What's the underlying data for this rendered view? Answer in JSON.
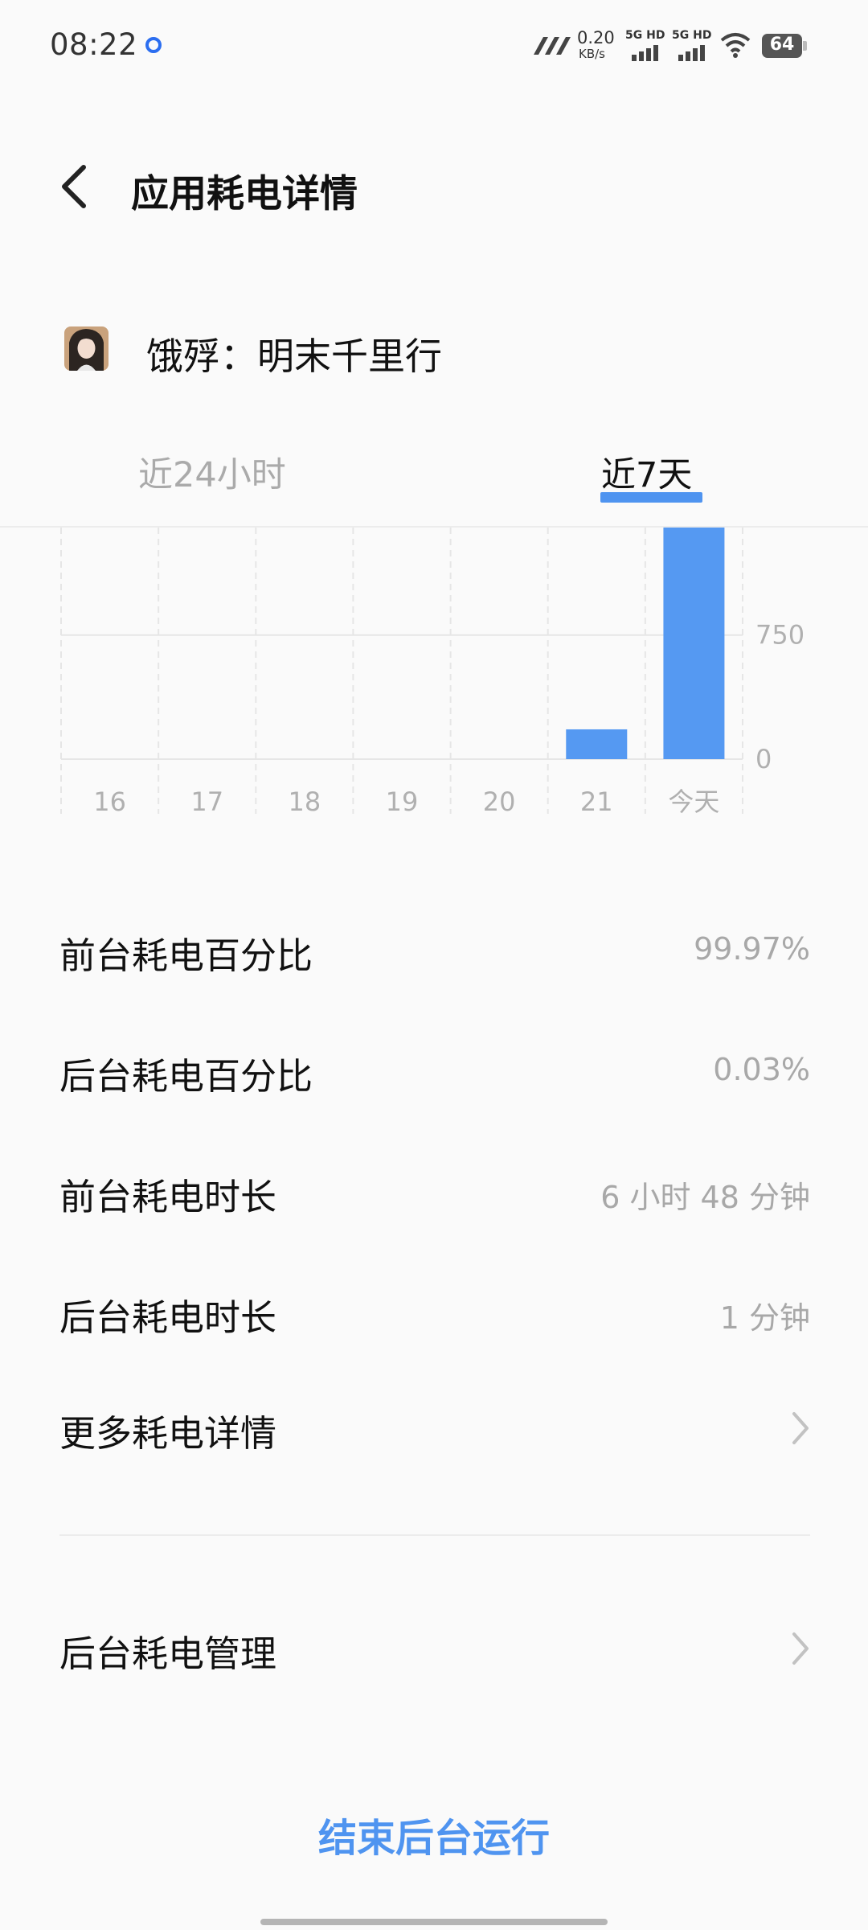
{
  "status_bar": {
    "time": "08:22",
    "speed_value": "0.20",
    "speed_unit": "KB/s",
    "sim1": "5G HD",
    "sim2": "5G HD",
    "battery": "64"
  },
  "header": {
    "title": "应用耗电详情"
  },
  "app": {
    "name": "饿殍：明末千里行"
  },
  "tabs": [
    {
      "label": "近24小时",
      "selected": false
    },
    {
      "label": "近7天",
      "selected": true
    }
  ],
  "chart_data": {
    "type": "bar",
    "categories": [
      "16",
      "17",
      "18",
      "19",
      "20",
      "21",
      "今天"
    ],
    "values": [
      0,
      0,
      0,
      0,
      0,
      180,
      1400
    ],
    "y_ticks": [
      "0",
      "750"
    ],
    "ylim": [
      0,
      1400
    ],
    "color": "#5599f2",
    "grid": true
  },
  "stats": [
    {
      "label": "前台耗电百分比",
      "value": "99.97%"
    },
    {
      "label": "后台耗电百分比",
      "value": "0.03%"
    },
    {
      "label": "前台耗电时长",
      "value": "6 小时 48 分钟"
    },
    {
      "label": "后台耗电时长",
      "value": "1 分钟"
    }
  ],
  "more_details": {
    "label": "更多耗电详情"
  },
  "background_management": {
    "label": "后台耗电管理"
  },
  "end_background": {
    "label": "结束后台运行"
  },
  "colors": {
    "accent": "#4f94f0",
    "bar": "#5599f2",
    "secondary_text": "#a8a8a8"
  }
}
